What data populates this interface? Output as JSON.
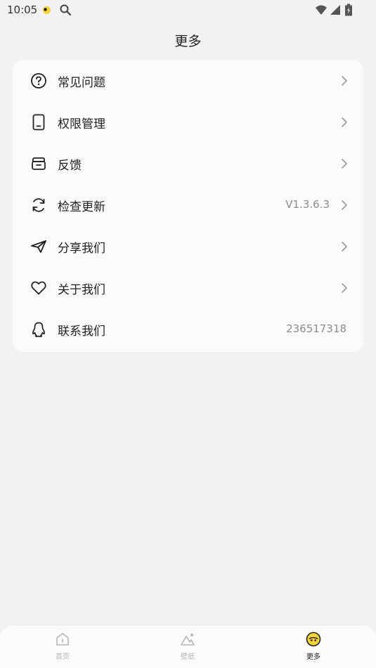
{
  "status_bar": {
    "time": "10:05",
    "icons": [
      "notification-dot-icon",
      "search-icon",
      "wifi-icon",
      "signal-icon",
      "battery-icon"
    ]
  },
  "header": {
    "title": "更多"
  },
  "menu": {
    "items": [
      {
        "label": "常见问题",
        "icon": "help-circle-icon",
        "value": "",
        "chevron": true
      },
      {
        "label": "权限管理",
        "icon": "phone-icon",
        "value": "",
        "chevron": true
      },
      {
        "label": "反馈",
        "icon": "feedback-icon",
        "value": "",
        "chevron": true
      },
      {
        "label": "检查更新",
        "icon": "refresh-icon",
        "value": "V1.3.6.3",
        "chevron": true
      },
      {
        "label": "分享我们",
        "icon": "send-icon",
        "value": "",
        "chevron": true
      },
      {
        "label": "关于我们",
        "icon": "heart-icon",
        "value": "",
        "chevron": true
      },
      {
        "label": "联系我们",
        "icon": "qq-icon",
        "value": "236517318",
        "chevron": false
      }
    ]
  },
  "bottom_nav": {
    "tabs": [
      {
        "label": "首页",
        "icon": "home-icon",
        "active": false
      },
      {
        "label": "壁纸",
        "icon": "wallpaper-icon",
        "active": false
      },
      {
        "label": "更多",
        "icon": "more-face-icon",
        "active": true
      }
    ]
  },
  "colors": {
    "background": "#f2f2f2",
    "card": "#fbfbfb",
    "text_primary": "#222222",
    "text_secondary": "#8c8c8c",
    "nav_inactive": "#b5b5b5",
    "accent_yellow": "#f5d43b"
  }
}
